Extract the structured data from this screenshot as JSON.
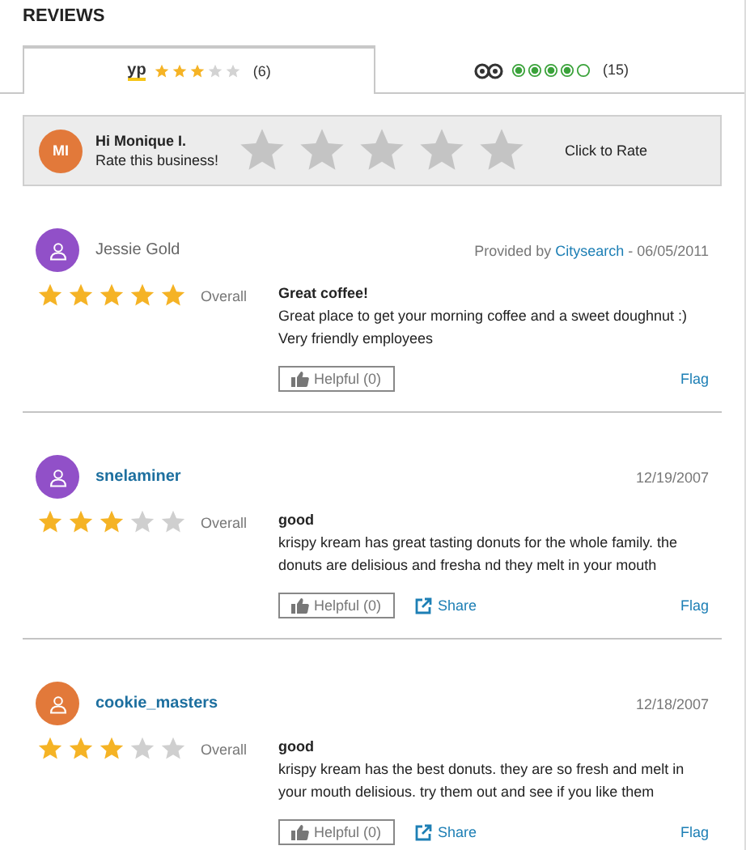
{
  "heading": "REVIEWS",
  "tabs": [
    {
      "kind": "yp",
      "logo": "yp",
      "stars": 3,
      "count": "(6)",
      "selected": true
    },
    {
      "kind": "owl",
      "stars": 4,
      "count": "(15)",
      "selected": false
    }
  ],
  "rate_box": {
    "initials": "MI",
    "color": "#e2793a",
    "greeting": "Hi Monique I.",
    "prompt": "Rate this business!",
    "stars": 0,
    "action": "Click to Rate"
  },
  "reviews": [
    {
      "name": "Jessie Gold",
      "name_link": false,
      "color": "#9150c8",
      "provider_prefix": "Provided by ",
      "provider": "Citysearch",
      "date": " - 06/05/2011",
      "stars": 5,
      "overall": "Overall",
      "title": "Great coffee!",
      "body": "Great place to get your morning coffee and a sweet doughnut :) Very friendly employees",
      "helpful": "Helpful (0)",
      "flag": "Flag"
    },
    {
      "name": "snelaminer",
      "name_link": true,
      "color": "#9150c8",
      "date": "12/19/2007",
      "stars": 3,
      "overall": "Overall",
      "title": "good",
      "body": "krispy kream has great tasting donuts for the whole family. the donuts are delisious and fresha nd they melt in your mouth",
      "helpful": "Helpful (0)",
      "share": "Share",
      "flag": "Flag"
    },
    {
      "name": "cookie_masters",
      "name_link": true,
      "color": "#e2793a",
      "date": "12/18/2007",
      "stars": 3,
      "overall": "Overall",
      "title": "good",
      "body": "krispy kream has the best donuts. they are so fresh and melt in your mouth delisious. try them out and see if you like them",
      "helpful": "Helpful (0)",
      "share": "Share",
      "flag": "Flag"
    }
  ]
}
